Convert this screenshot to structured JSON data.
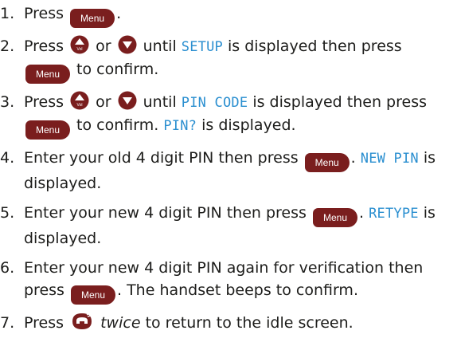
{
  "keys": {
    "menu": "Menu",
    "vol": "Vol"
  },
  "steps": [
    {
      "num": "1.",
      "t0": "Press",
      "t1": "."
    },
    {
      "num": "2.",
      "t0": "Press",
      "or": "or",
      "t1": "until",
      "lcd": "SETUP",
      "t2": "is displayed then press",
      "t3": "to confirm."
    },
    {
      "num": "3.",
      "t0": "Press",
      "or": "or",
      "t1": "until",
      "lcd": "PIN CODE",
      "t2": "is displayed then press",
      "t3": "to confirm.",
      "lcd2": "PIN?",
      "t4": "is displayed."
    },
    {
      "num": "4.",
      "t0": "Enter your old 4 digit PIN then press",
      "t1": ".",
      "lcd": "NEW PIN",
      "t2": "is displayed."
    },
    {
      "num": "5.",
      "t0": "Enter your new 4 digit PIN then press",
      "t1": ".",
      "lcd": "RETYPE",
      "t2": "is displayed."
    },
    {
      "num": "6.",
      "t0": "Enter your new 4 digit PIN again for verification then press",
      "t1": ". The handset beeps to confirm."
    },
    {
      "num": "7.",
      "t0": "Press",
      "em": "twice",
      "t1": "to return to the idle screen."
    }
  ],
  "colors": {
    "menu_key": "#7a1e1e",
    "lcd_text": "#2b8fd0",
    "body_text": "#1d1d1b"
  },
  "icons": [
    "menu-button-icon",
    "up-vol-button-icon",
    "down-button-icon",
    "end-call-button-icon"
  ]
}
